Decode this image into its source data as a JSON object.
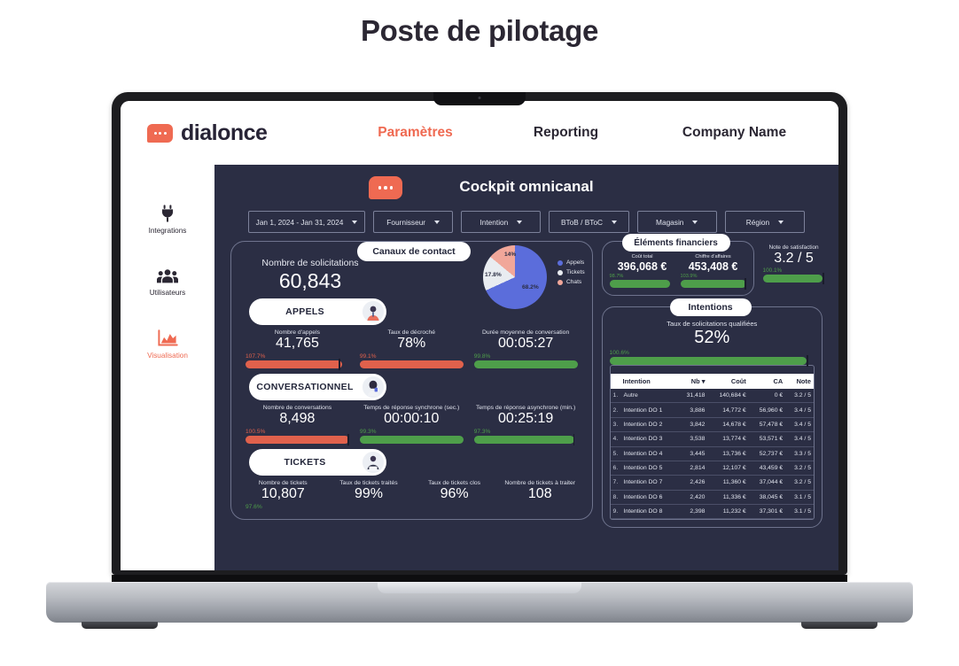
{
  "page": {
    "title": "Poste de pilotage"
  },
  "topbar": {
    "brand": "dialonce",
    "logo_icon": "dialonce-chat-logo",
    "nav": [
      {
        "label": "Paramètres",
        "active": true
      },
      {
        "label": "Reporting",
        "active": false
      },
      {
        "label": "Company Name",
        "active": false
      }
    ]
  },
  "sidebar": {
    "items": [
      {
        "label": "Integrations",
        "icon": "plug-icon",
        "active": false
      },
      {
        "label": "Utilisateurs",
        "icon": "users-icon",
        "active": false
      },
      {
        "label": "Visualisation",
        "icon": "area-chart-icon",
        "active": true
      }
    ]
  },
  "dashboard": {
    "title": "Cockpit omnicanal",
    "logo_icon": "dialonce-chat-logo",
    "filters": [
      {
        "label": "Jan 1, 2024 - Jan 31, 2024"
      },
      {
        "label": "Fournisseur"
      },
      {
        "label": "Intention"
      },
      {
        "label": "BToB / BToC"
      },
      {
        "label": "Magasin"
      },
      {
        "label": "Région"
      }
    ],
    "solicitations": {
      "label": "Nombre de solicitations",
      "value": "60,843"
    },
    "canaux_pill": "Canaux de contact",
    "sections": [
      {
        "name": "APPELS",
        "avatar": "call-agent-avatar",
        "metrics": [
          {
            "label": "Nombre d'appels",
            "value": "41,765",
            "pct": "107.7%",
            "color": "red",
            "fill": 93,
            "marker": true
          },
          {
            "label": "Taux de décroché",
            "value": "78%",
            "pct": "99.1%",
            "color": "red",
            "fill": 100,
            "marker": false
          },
          {
            "label": "Durée moyenne de conversation",
            "value": "00:05:27",
            "pct": "99.8%",
            "color": "green",
            "fill": 100,
            "marker": false
          }
        ]
      },
      {
        "name": "CONVERSATIONNEL",
        "avatar": "chat-agent-avatar",
        "metrics": [
          {
            "label": "Nombre de conversations",
            "value": "8,498",
            "pct": "100.5%",
            "color": "red",
            "fill": 100,
            "marker": true
          },
          {
            "label": "Temps de réponse synchrone (sec.)",
            "value": "00:00:10",
            "pct": "99.3%",
            "color": "green",
            "fill": 100,
            "marker": false
          },
          {
            "label": "Temps de réponse asynchrone (min.)",
            "value": "00:25:19",
            "pct": "97.3%",
            "color": "green",
            "fill": 97,
            "marker": true
          }
        ]
      },
      {
        "name": "TICKETS",
        "avatar": "ticket-agent-avatar",
        "metrics": [
          {
            "label": "Nombre de tickets",
            "value": "10,807",
            "pct": "97.6%",
            "color": "green",
            "fill": 98,
            "marker": false
          },
          {
            "label": "Taux de tickets traités",
            "value": "99%",
            "pct": "",
            "color": "green",
            "fill": 100,
            "marker": false
          },
          {
            "label": "Taux de tickets clos",
            "value": "96%",
            "pct": "",
            "color": "green",
            "fill": 100,
            "marker": false
          },
          {
            "label": "Nombre de tickets à traiter",
            "value": "108",
            "pct": "",
            "color": "green",
            "fill": 100,
            "marker": false
          }
        ]
      }
    ],
    "financials": {
      "pill": "Éléments financiers",
      "items": [
        {
          "label": "Coût total",
          "value": "396,068 €",
          "pct": "98.7%",
          "fill": 92
        },
        {
          "label": "Chiffre d'affaires",
          "value": "453,408 €",
          "pct": "103.9%",
          "fill": 100
        }
      ]
    },
    "satisfaction": {
      "label": "Note de satisfaction",
      "value": "3.2 / 5",
      "pct": "100.1%",
      "fill": 96
    },
    "intentions": {
      "pill": "Intentions",
      "rate_label": "Taux de solicitations qualifiées",
      "rate_value": "52%",
      "rate_pct": "100.6%",
      "rate_fill": 96,
      "columns": [
        "Intention",
        "Nb",
        "Coût",
        "CA",
        "Note"
      ],
      "sort_column": "Nb",
      "rows": [
        {
          "idx": "1.",
          "intention": "Autre",
          "nb": "31,418",
          "cout": "140,684 €",
          "ca": "0 €",
          "note": "3.2 / 5"
        },
        {
          "idx": "2.",
          "intention": "Intention DO 1",
          "nb": "3,886",
          "cout": "14,772 €",
          "ca": "56,960 €",
          "note": "3.4 / 5"
        },
        {
          "idx": "3.",
          "intention": "Intention DO 2",
          "nb": "3,842",
          "cout": "14,678 €",
          "ca": "57,478 €",
          "note": "3.4 / 5"
        },
        {
          "idx": "4.",
          "intention": "Intention DO 3",
          "nb": "3,538",
          "cout": "13,774 €",
          "ca": "53,571 €",
          "note": "3.4 / 5"
        },
        {
          "idx": "5.",
          "intention": "Intention DO 4",
          "nb": "3,445",
          "cout": "13,736 €",
          "ca": "52,737 €",
          "note": "3.3 / 5"
        },
        {
          "idx": "6.",
          "intention": "Intention DO 5",
          "nb": "2,814",
          "cout": "12,107 €",
          "ca": "43,459 €",
          "note": "3.2 / 5"
        },
        {
          "idx": "7.",
          "intention": "Intention DO 7",
          "nb": "2,426",
          "cout": "11,360 €",
          "ca": "37,044 €",
          "note": "3.2 / 5"
        },
        {
          "idx": "8.",
          "intention": "Intention DO 6",
          "nb": "2,420",
          "cout": "11,336 €",
          "ca": "38,045 €",
          "note": "3.1 / 5"
        },
        {
          "idx": "9.",
          "intention": "Intention DO 8",
          "nb": "2,398",
          "cout": "11,232 €",
          "ca": "37,301 €",
          "note": "3.1 / 5"
        }
      ]
    }
  },
  "chart_data": {
    "type": "pie",
    "title": "Canaux de contact",
    "categories": [
      "Appels",
      "Tickets",
      "Chats"
    ],
    "values": [
      68.2,
      17.8,
      14.0
    ],
    "labels": [
      "68.2%",
      "17.8%",
      "14%"
    ],
    "colors": [
      "#5b6ddb",
      "#e9ecf1",
      "#f1a79a"
    ],
    "legend_position": "right",
    "unit": "percent"
  },
  "colors": {
    "accent": "#ef6a52",
    "dark_panel": "#2b2e44",
    "bar_red": "#e0614c",
    "bar_green": "#4e9e4a",
    "pie_blue": "#5b6ddb",
    "pie_white": "#e9ecf1",
    "pie_pink": "#f1a79a"
  }
}
